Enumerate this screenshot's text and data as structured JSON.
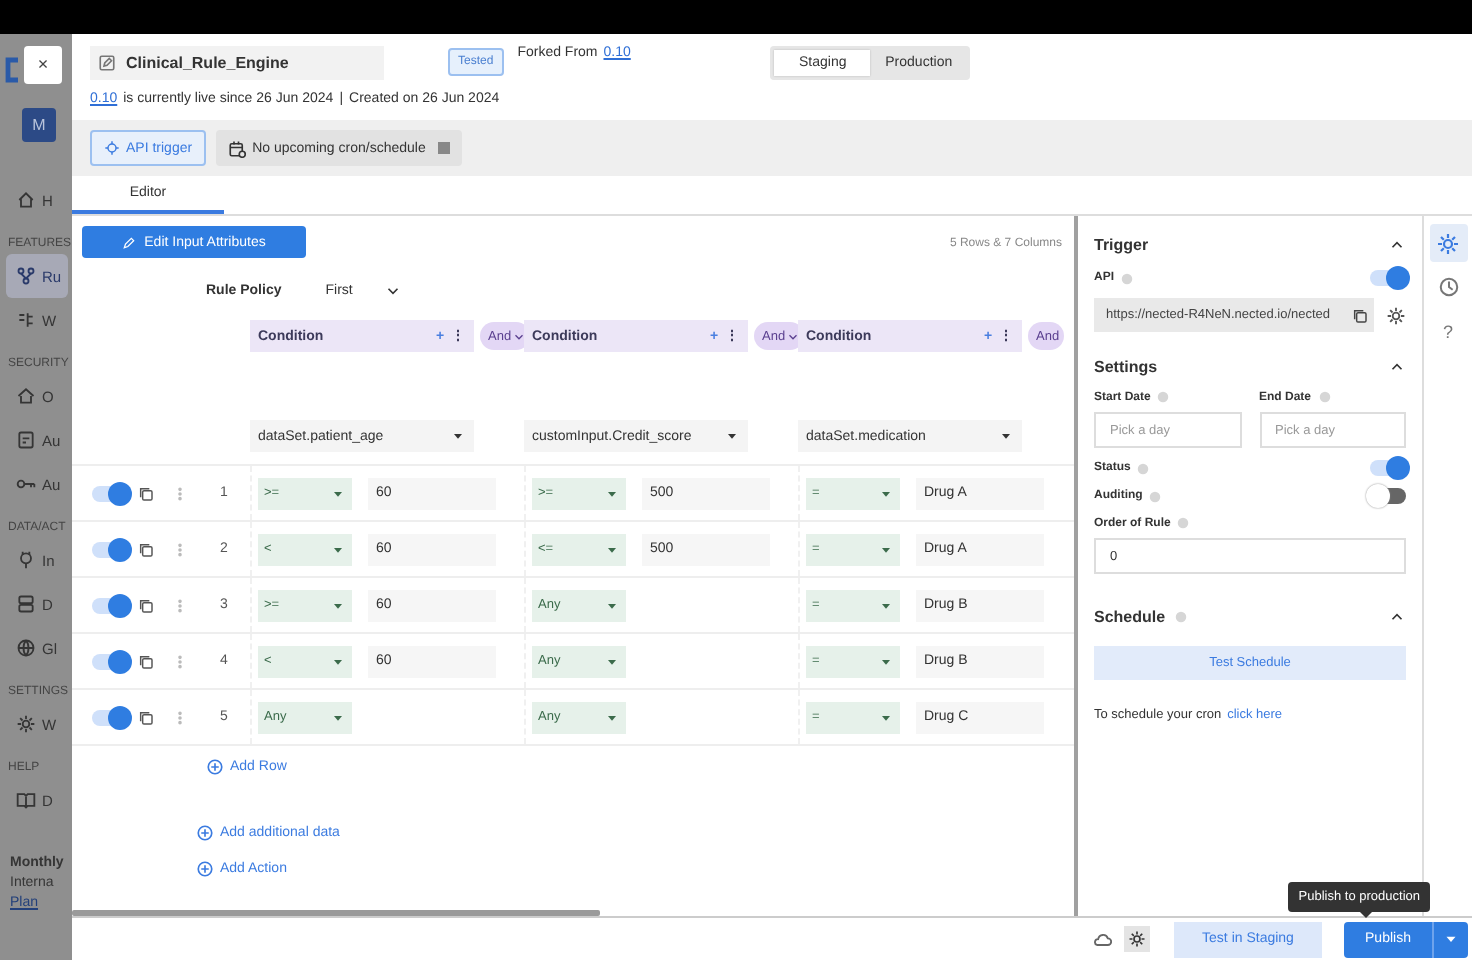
{
  "sidebar": {
    "avatar": "M",
    "groups": [
      {
        "items": [
          {
            "label": "H",
            "selected": false
          }
        ]
      },
      {
        "heading": "FEATURES",
        "items": [
          {
            "label": "Ru",
            "selected": true
          },
          {
            "label": "W",
            "selected": false
          }
        ]
      },
      {
        "heading": "SECURITY",
        "items": [
          {
            "label": "O",
            "selected": false
          },
          {
            "label": "Au",
            "selected": false
          },
          {
            "label": "Au",
            "selected": false
          }
        ]
      },
      {
        "heading": "DATA/ACT",
        "items": [
          {
            "label": "In",
            "selected": false
          },
          {
            "label": "D",
            "selected": false
          },
          {
            "label": "Gl",
            "selected": false
          }
        ]
      },
      {
        "heading": "SETTINGS",
        "items": [
          {
            "label": "W",
            "selected": false
          }
        ]
      },
      {
        "heading": "HELP",
        "items": [
          {
            "label": "D",
            "selected": false
          }
        ]
      }
    ],
    "plan": {
      "title": "Monthly",
      "subtitle": "Interna",
      "link": "Plan"
    }
  },
  "close": "×",
  "header": {
    "rule_name": "Clinical_Rule_Engine",
    "badge": "Tested",
    "forked_label": "Forked From",
    "forked_version": "0.10",
    "live_version": "0.10",
    "live_text": "is currently live since 26 Jun 2024",
    "separator": "|",
    "created": "Created on 26 Jun 2024",
    "environments": [
      {
        "label": "Staging",
        "selected": true
      },
      {
        "label": "Production",
        "selected": false
      }
    ]
  },
  "trigger_bar": {
    "api_button": "API trigger",
    "schedule_chip": "No upcoming cron/schedule"
  },
  "tabs": [
    {
      "label": "Editor",
      "selected": true
    }
  ],
  "editor": {
    "edit_button": "Edit Input Attributes",
    "size_note": "5 Rows & 7 Columns",
    "rule_policy": {
      "label": "Rule Policy",
      "value": "First"
    },
    "columns": [
      {
        "title": "Condition",
        "add": "+",
        "menu": "⋮",
        "joiner": "And",
        "joiner_caret": true,
        "attribute": "dataSet.patient_age"
      },
      {
        "title": "Condition",
        "add": "+",
        "menu": "⋮",
        "joiner": "And",
        "joiner_caret": true,
        "attribute": "customInput.Credit_score"
      },
      {
        "title": "Condition",
        "add": "+",
        "menu": "⋮",
        "joiner": "And",
        "joiner_caret": false,
        "attribute": "dataSet.medication"
      }
    ],
    "rows": [
      {
        "enabled": true,
        "number": "1",
        "cells": [
          {
            "operator": ">=",
            "value": "60"
          },
          {
            "operator": ">=",
            "value": "500"
          },
          {
            "operator": "=",
            "value": "Drug A"
          }
        ]
      },
      {
        "enabled": true,
        "number": "2",
        "cells": [
          {
            "operator": "<",
            "value": "60"
          },
          {
            "operator": "<=",
            "value": "500"
          },
          {
            "operator": "=",
            "value": "Drug A"
          }
        ]
      },
      {
        "enabled": true,
        "number": "3",
        "cells": [
          {
            "operator": ">=",
            "value": "60"
          },
          {
            "operator": "Any"
          },
          {
            "operator": "=",
            "value": "Drug B"
          }
        ]
      },
      {
        "enabled": true,
        "number": "4",
        "cells": [
          {
            "operator": "<",
            "value": "60"
          },
          {
            "operator": "Any"
          },
          {
            "operator": "=",
            "value": "Drug B"
          }
        ]
      },
      {
        "enabled": true,
        "number": "5",
        "cells": [
          {
            "operator": "Any"
          },
          {
            "operator": "Any"
          },
          {
            "operator": "=",
            "value": "Drug C"
          }
        ]
      }
    ],
    "add_row": "Add Row",
    "add_data": "Add additional data",
    "add_action": "Add Action"
  },
  "panel": {
    "trigger": {
      "title": "Trigger",
      "expanded": true,
      "api_label": "API",
      "api_on": true,
      "url": "https://nected-R4NeN.nected.io/nected"
    },
    "settings": {
      "title": "Settings",
      "expanded": true,
      "start_label": "Start Date",
      "start_placeholder": "Pick a day",
      "end_label": "End Date",
      "end_placeholder": "Pick a day",
      "status_label": "Status",
      "status_on": true,
      "auditing_label": "Auditing",
      "auditing_on": false,
      "order_label": "Order of Rule",
      "order_value": "0"
    },
    "schedule": {
      "title": "Schedule",
      "expanded": true,
      "test_button": "Test Schedule",
      "hint": "To schedule your cron",
      "link": "click here"
    }
  },
  "rail": [
    {
      "kind": "settings",
      "selected": true
    },
    {
      "kind": "history",
      "selected": false
    },
    {
      "kind": "help",
      "glyph": "?",
      "selected": false
    }
  ],
  "footer": {
    "test_button": "Test in Staging",
    "publish_button": "Publish",
    "tooltip": "Publish to production"
  }
}
